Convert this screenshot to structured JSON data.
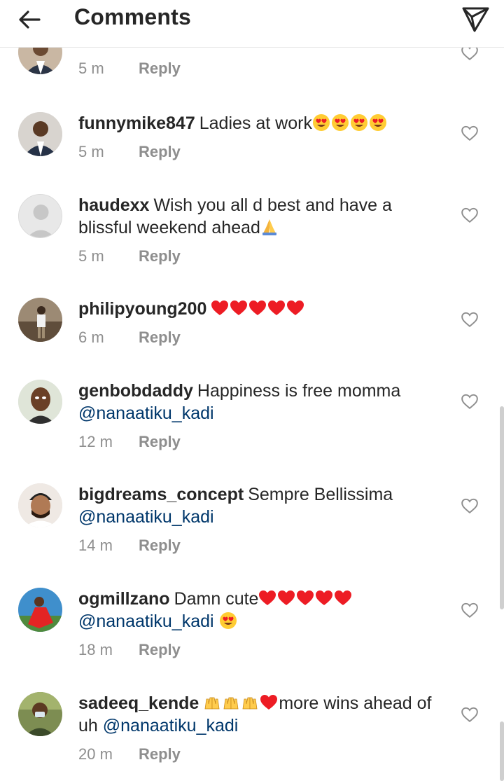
{
  "header": {
    "title": "Comments",
    "back_icon": "arrow-left-icon",
    "send_icon": "send-icon"
  },
  "comments": [
    {
      "username": "",
      "text": "",
      "mention": "",
      "time": "5 m",
      "reply": "Reply"
    },
    {
      "username": "funnymike847",
      "text": "Ladies at work",
      "mention": "",
      "time": "5 m",
      "reply": "Reply",
      "emoji": [
        "heart-eyes",
        "heart-eyes",
        "heart-eyes",
        "heart-eyes"
      ]
    },
    {
      "username": "haudexx",
      "text": "Wish you all d best and have a blissful weekend ahead",
      "mention": "",
      "time": "5 m",
      "reply": "Reply",
      "emoji": [
        "praying-hands"
      ]
    },
    {
      "username": "philipyoung200",
      "text": "",
      "mention": "",
      "time": "6 m",
      "reply": "Reply",
      "emoji": [
        "red-heart",
        "red-heart",
        "red-heart",
        "red-heart",
        "red-heart"
      ]
    },
    {
      "username": "genbobdaddy",
      "text": "Happiness is free momma",
      "mention": "@nanaatiku_kadi",
      "time": "12 m",
      "reply": "Reply"
    },
    {
      "username": "bigdreams_concept",
      "text": "Sempre Bellissima",
      "mention": "@nanaatiku_kadi",
      "time": "14 m",
      "reply": "Reply"
    },
    {
      "username": "ogmillzano",
      "text": "Damn cute",
      "mention": "@nanaatiku_kadi",
      "time": "18 m",
      "reply": "Reply",
      "emoji": [
        "red-heart",
        "red-heart",
        "red-heart",
        "red-heart",
        "red-heart",
        "heart-eyes"
      ]
    },
    {
      "username": "sadeeq_kende",
      "text": "more wins ahead of uh",
      "mention": "@nanaatiku_kadi",
      "time": "20 m",
      "reply": "Reply",
      "emoji": [
        "raising-hands",
        "raising-hands",
        "raising-hands",
        "red-heart"
      ]
    }
  ],
  "colors": {
    "text": "#262626",
    "muted": "#8e8e8e",
    "mention": "#00376b",
    "heart": "#ed1c24",
    "emoji_yellow": "#ffcc33"
  }
}
